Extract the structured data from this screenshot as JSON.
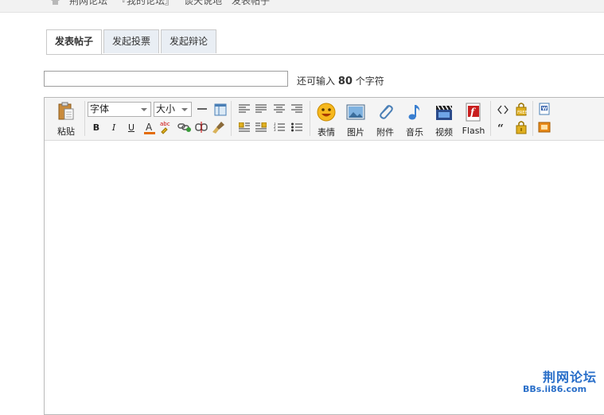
{
  "breadcrumb": {
    "items": [
      "荆网论坛",
      "『我的论坛』",
      "谈天说地",
      "发表帖子"
    ]
  },
  "tabs": [
    {
      "label": "发表帖子",
      "active": true
    },
    {
      "label": "发起投票",
      "active": false
    },
    {
      "label": "发起辩论",
      "active": false
    }
  ],
  "subject": {
    "value": "",
    "placeholder": ""
  },
  "counter": {
    "prefix": "还可输入",
    "count": "80",
    "suffix": "个字符"
  },
  "toolbar": {
    "paste_label": "粘贴",
    "font_select": "字体",
    "size_select": "大小",
    "format_buttons": [
      "B",
      "I",
      "U"
    ],
    "large_buttons": [
      {
        "label": "表情",
        "icon": "smiley-icon"
      },
      {
        "label": "图片",
        "icon": "image-icon"
      },
      {
        "label": "附件",
        "icon": "paperclip-icon"
      },
      {
        "label": "音乐",
        "icon": "music-note-icon"
      },
      {
        "label": "视频",
        "icon": "clapperboard-icon"
      },
      {
        "label": "Flash",
        "icon": "flash-icon"
      }
    ]
  },
  "watermark": {
    "line1": "荆网论坛",
    "line2": "BBs.ii86.com"
  }
}
